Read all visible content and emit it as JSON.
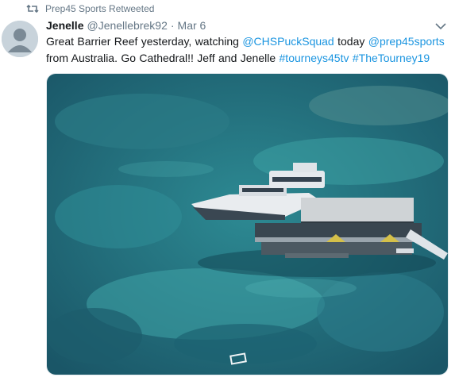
{
  "retweet": {
    "icon": "retweet-icon",
    "label": "Prep45 Sports Retweeted"
  },
  "tweet": {
    "avatar_icon": "default-avatar-icon",
    "display_name": "Jenelle",
    "handle": "@Jenellebrek92",
    "separator": "·",
    "timestamp": "Mar 6",
    "caret_icon": "chevron-down-icon",
    "text": {
      "part1": "Great Barrier Reef yesterday, watching ",
      "mention1": "@CHSPuckSquad",
      "part2": " today ",
      "mention2": "@prep45sports",
      "part3": " from Australia. Go Cathedral!!  Jeff and Jenelle  ",
      "hashtag1": "#tourneys45tv",
      "space": " ",
      "hashtag2": "#TheTourney19"
    },
    "media_description_icon": "photo-boat-on-reef"
  },
  "colors": {
    "link": "#1b95e0",
    "secondary_text": "#657786",
    "primary_text": "#14171a",
    "water_deep": "#1d5f6e",
    "water_shallow": "#3aa0a4"
  }
}
